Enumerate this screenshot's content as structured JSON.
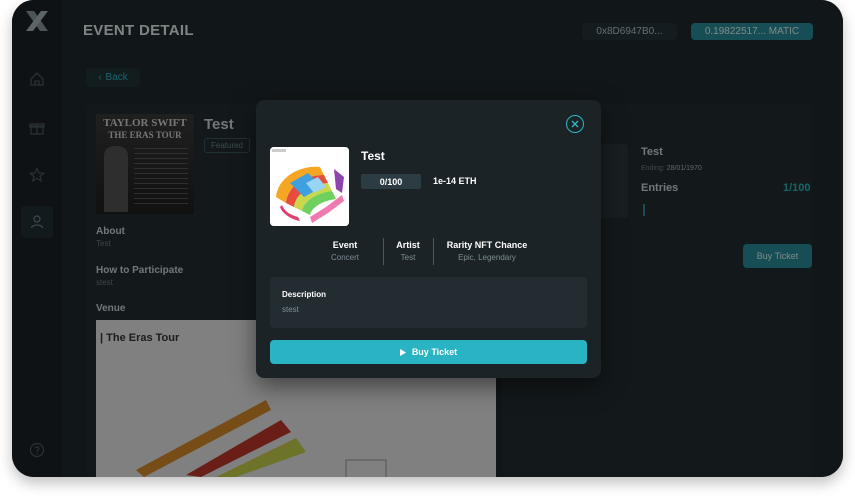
{
  "app": {
    "logo_icon": "x-logo-icon"
  },
  "sidebar": {
    "items": [
      {
        "name": "home",
        "icon": "home-icon"
      },
      {
        "name": "gift",
        "icon": "gift-icon"
      },
      {
        "name": "star",
        "icon": "star-icon"
      },
      {
        "name": "profile",
        "icon": "user-icon",
        "active": true
      },
      {
        "name": "help",
        "icon": "help-icon"
      }
    ]
  },
  "header": {
    "title": "EVENT DETAIL",
    "wallet_address": "0x8D6947B0...",
    "balance": "0.19822517... MATIC"
  },
  "back_button": {
    "label": "Back"
  },
  "event": {
    "poster_title_line1": "TAYLOR SWIFT",
    "poster_title_line2": "THE ERAS TOUR",
    "name": "Test",
    "featured_badge": "Featured",
    "about_label": "About",
    "about_value": "Test",
    "how_label": "How to Participate",
    "how_value": "stest",
    "venue_label": "Venue",
    "venue_map_title": "| The Eras Tour"
  },
  "side_panel": {
    "title": "Test",
    "ending_label": "Ending:",
    "ending_value": "28/01/1970",
    "entries_label": "Entries",
    "entries_value": "1/100",
    "buy_label": "Buy Ticket"
  },
  "modal": {
    "title": "Test",
    "count": "0/100",
    "price": "1e-14 ETH",
    "columns": [
      {
        "label": "Event",
        "value": "Concert"
      },
      {
        "label": "Artist",
        "value": "Test"
      },
      {
        "label": "Rarity NFT Chance",
        "value": "Epic, Legendary"
      }
    ],
    "description_label": "Description",
    "description_value": "stest",
    "buy_button": "Buy Ticket"
  },
  "colors": {
    "accent": "#2ab3c3",
    "background": "#1f282c",
    "modal": "#1b2327"
  }
}
